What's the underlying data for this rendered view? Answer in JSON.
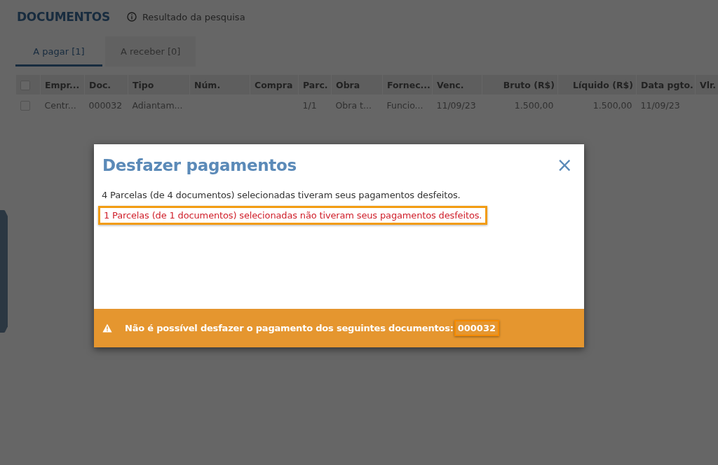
{
  "page": {
    "title": "DOCUMENTOS",
    "subtitle": "Resultado da pesquisa"
  },
  "tabs": [
    {
      "label": "A pagar [1]",
      "selected": true
    },
    {
      "label": "A receber [0]",
      "selected": false
    }
  ],
  "table": {
    "columns": [
      {
        "label": "Empr...",
        "kind": "text"
      },
      {
        "label": "Doc.",
        "kind": "text"
      },
      {
        "label": "Tipo",
        "kind": "text"
      },
      {
        "label": "Núm.",
        "kind": "text"
      },
      {
        "label": "Compra",
        "kind": "text"
      },
      {
        "label": "Parc.",
        "kind": "text"
      },
      {
        "label": "Obra",
        "kind": "text"
      },
      {
        "label": "Fornec...",
        "kind": "text"
      },
      {
        "label": "Venc.",
        "kind": "text"
      },
      {
        "label": "Bruto (R$)",
        "kind": "money"
      },
      {
        "label": "Líquido (R$)",
        "kind": "money"
      },
      {
        "label": "Data pgto.",
        "kind": "text"
      },
      {
        "label": "Vlr.",
        "kind": "text"
      }
    ],
    "header_checked": false,
    "rows": [
      {
        "checked": false,
        "cells": [
          "Centr...",
          "000032",
          "Adiantam...",
          "",
          "",
          "1/1",
          "Obra t...",
          "Funcio...",
          "11/09/23",
          "1.500,00",
          "1.500,00",
          "11/09/23",
          ""
        ]
      }
    ]
  },
  "dialog": {
    "title": "Desfazer pagamentos",
    "close": "×",
    "messages": [
      {
        "text": "4 Parcelas (de 4 documentos) selecionadas tiveram seus pagamentos desfeitos.",
        "kind": "success",
        "highlighted": false
      },
      {
        "text": "1 Parcelas (de 1 documentos) selecionadas não tiveram seus pagamentos desfeitos.",
        "kind": "error",
        "highlighted": true
      }
    ],
    "warning": {
      "text": "Não é possível desfazer o pagamento dos seguintes documentos:",
      "documents": [
        {
          "text": "000032",
          "highlighted": true
        }
      ]
    }
  }
}
